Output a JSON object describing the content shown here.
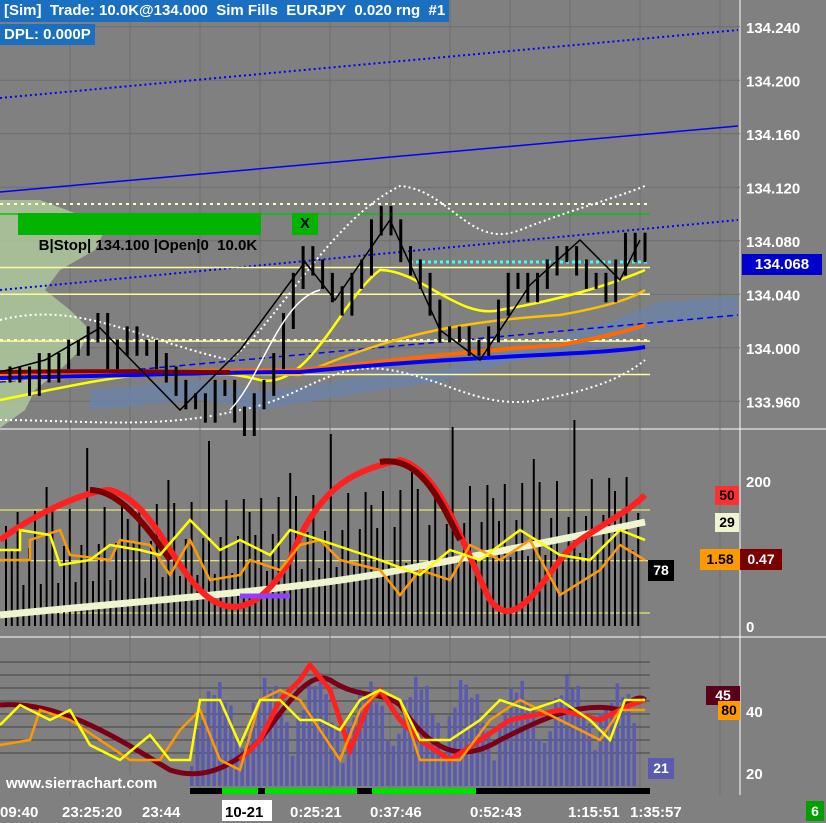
{
  "header": {
    "line1": "[Sim]  Trade: 10.0K@134.000  Sim Fills  EURJPY  0.020 rng  #1",
    "line2": "DPL: 0.000P"
  },
  "colors": {
    "background": "#808080",
    "axis_bg": "#7f7f7f",
    "grid": "#6e6e6e",
    "price_up": "#000000",
    "ema_yellow": "#ffff00",
    "ema_orange": "#ffa500",
    "ema_red": "#ff3300",
    "ema_blue": "#0000ff",
    "ema_maroon": "#800000",
    "bands_white": "#ffffff",
    "order_line": "#00c800",
    "price_badge": "#0000cc",
    "cci_red": "#ff2020",
    "cci_maroon": "#7a0000",
    "cci_cream": "#f0f5d0",
    "cci_orange": "#ff9900",
    "cci_yellow": "#ffff00",
    "stoch_bars": "#5a5ab0"
  },
  "order_label": {
    "text": "B|Stop| 134.100 |Open|0  10.0K",
    "close": "X"
  },
  "price_panel": {
    "price_badge": "134.068",
    "y_ticks": [
      "134.240",
      "134.200",
      "134.160",
      "134.120",
      "134.080",
      "134.040",
      "134.000",
      "133.960"
    ]
  },
  "indicator_panel": {
    "y_ticks": [
      "200",
      "0"
    ],
    "badges": {
      "red": "50",
      "cream": "29",
      "orange": "1.58",
      "maroon": "0.47",
      "black": "78"
    }
  },
  "oscillator_panel": {
    "y_ticks": [
      "40",
      "20"
    ],
    "badges": {
      "maroon": "45",
      "orange": "80",
      "blue": "21"
    },
    "watermark": "www.sierrachart.com"
  },
  "time_axis": {
    "labels": [
      "09:40",
      "23:25:20",
      "23:44",
      "10-21",
      "0:25:21",
      "0:37:46",
      "0:52:43",
      "1:15:51",
      "1:35:57"
    ],
    "corner": "6"
  },
  "chart_data": {
    "type": "line",
    "symbol": "EURJPY",
    "price_range": [
      133.94,
      134.26
    ],
    "closes": [
      133.98,
      133.98,
      133.97,
      133.99,
      133.98,
      133.99,
      134.0,
      134.0,
      134.01,
      134.02,
      133.99,
      134.0,
      134.01,
      134.0,
      134.0,
      133.99,
      133.98,
      133.97,
      133.96,
      133.96,
      133.95,
      133.97,
      133.97,
      133.95,
      133.94,
      133.96,
      133.97,
      133.99,
      134.02,
      134.05,
      134.07,
      134.06,
      134.05,
      134.04,
      134.03,
      134.05,
      134.06,
      134.09,
      134.1,
      134.09,
      134.07,
      134.06,
      134.05,
      134.03,
      134.01,
      134.01,
      134.01,
      134.0,
      134.0,
      134.01,
      134.03,
      134.05,
      134.05,
      134.04,
      134.05,
      134.06,
      134.07,
      134.07,
      134.06,
      134.05,
      134.05,
      134.04,
      134.06,
      134.08,
      134.07,
      134.08
    ],
    "stop_order_price": 134.1,
    "last_price": 134.068
  }
}
